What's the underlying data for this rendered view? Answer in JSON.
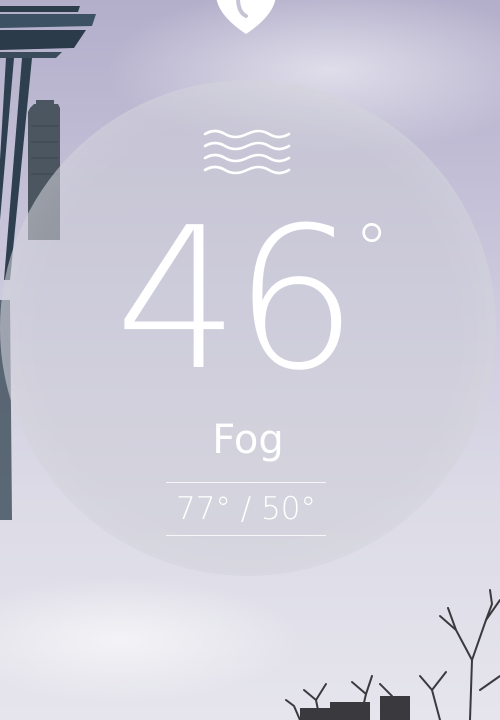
{
  "weather": {
    "temperature": "46",
    "degree_symbol": "°",
    "condition": "Fog",
    "high_low": "77° / 50°",
    "condition_icon": "fog-icon",
    "location_icon": "map-pin-icon"
  },
  "colors": {
    "text": "#ffffff",
    "dial": "#cdcdd7",
    "sky": "#bebad3"
  }
}
